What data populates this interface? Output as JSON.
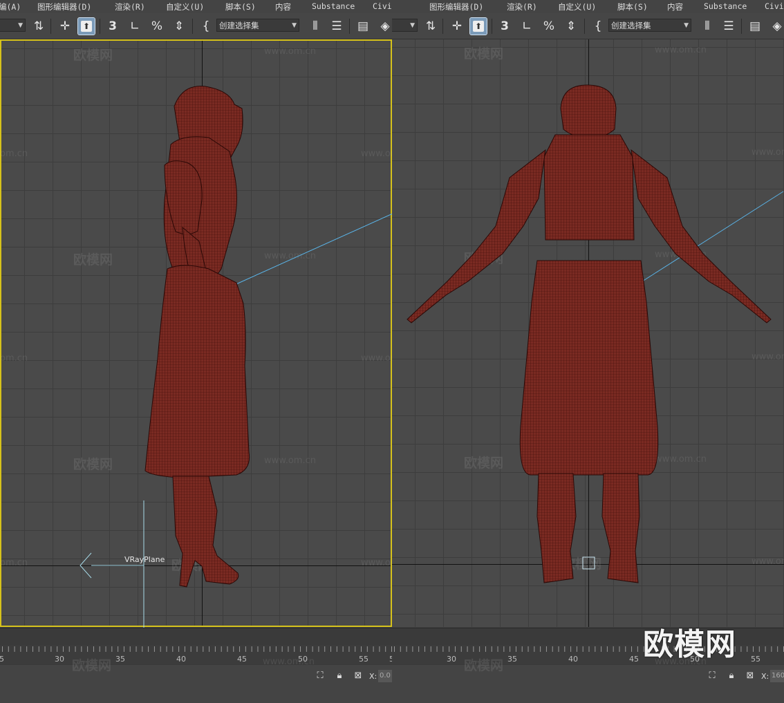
{
  "menu": [
    "编(A)",
    "图形编辑器(D)",
    "渲染(R)",
    "自定义(U)",
    "脚本(S)",
    "内容",
    "Substance",
    "Civil"
  ],
  "menu_right_extra": "Civi",
  "toolbar": {
    "angle_snap_digit": "3",
    "named_selection_label": "创建选择集",
    "icons": [
      "selection-filter-icon",
      "move-icon",
      "select-object-icon",
      "snap-3d-icon",
      "angle-snap-icon",
      "percent-snap-icon",
      "spinner-snap-icon",
      "named-selection-brackets-icon",
      "mirror-icon",
      "align-icon",
      "scene-explorer-icon",
      "layer-explorer-icon"
    ]
  },
  "viewports": {
    "left": {
      "label": "VRayPlane",
      "active": true
    },
    "right": {
      "active": false
    }
  },
  "watermarks": {
    "logo_text": "欧模网",
    "url_text": "www.om.cn",
    "url_text_short": "om.cn"
  },
  "timeline": {
    "left_ticks": [
      "5",
      "30",
      "35",
      "40",
      "45",
      "50",
      "55",
      "5"
    ],
    "right_ticks": [
      "30",
      "35",
      "40",
      "45",
      "50",
      "55"
    ]
  },
  "status": {
    "x_label": "X:",
    "left_x_value": "0.0",
    "right_x_value": "160"
  },
  "brand": "欧模网",
  "colors": {
    "mesh": "#7a2a22",
    "wire": "#3a0c08",
    "active_border": "#d6c21a",
    "light_line": "#5ab4e8"
  }
}
